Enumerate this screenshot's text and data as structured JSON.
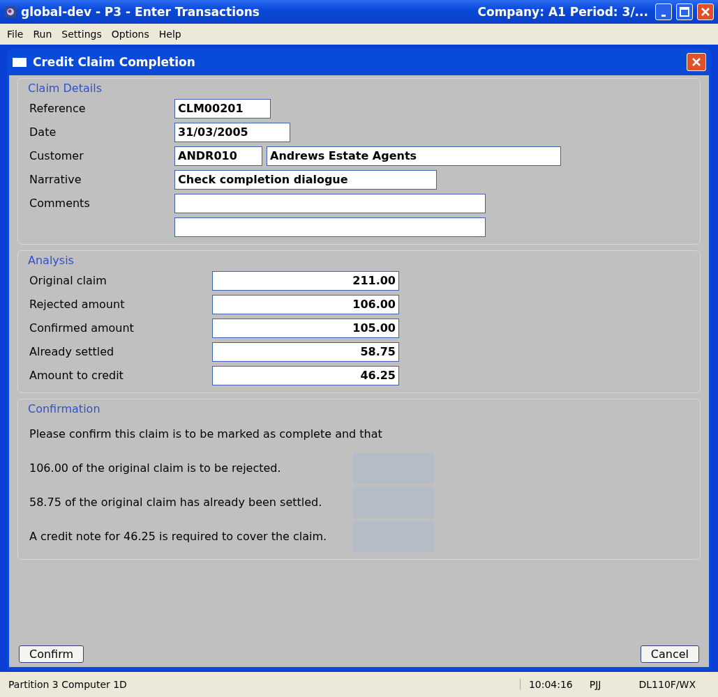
{
  "window": {
    "title": "global-dev - P3 - Enter Transactions",
    "info": "Company: A1  Period:  3/..."
  },
  "menu": [
    "File",
    "Run",
    "Settings",
    "Options",
    "Help"
  ],
  "dialog": {
    "title": "Credit Claim Completion"
  },
  "claim_details": {
    "title": "Claim Details",
    "fields": [
      {
        "kind": "filled",
        "label": "Reference",
        "values": [
          "CLM00201"
        ]
      },
      {
        "kind": "filled",
        "label": "Date",
        "values": [
          "31/03/2005"
        ]
      },
      {
        "kind": "filled",
        "label": "Customer",
        "values": [
          "ANDR010",
          "Andrews Estate Agents"
        ]
      },
      {
        "kind": "filled",
        "label": "Narrative",
        "values": [
          "Check completion dialogue"
        ]
      },
      {
        "kind": "empty",
        "label": "Comments"
      },
      {
        "kind": "empty"
      }
    ]
  },
  "analysis": {
    "title": "Analysis",
    "fields": [
      {
        "label": "Original claim",
        "value": "211.00"
      },
      {
        "label": "Rejected amount",
        "value": "106.00"
      },
      {
        "label": "Confirmed amount",
        "value": "105.00"
      },
      {
        "label": "Already settled",
        "value": "58.75"
      },
      {
        "label": "Amount to credit",
        "value": "46.25"
      }
    ]
  },
  "confirmation": {
    "title": "Confirmation",
    "lines": [
      "Please confirm this claim is to be marked as complete and that",
      "106.00 of the original claim is to be rejected.",
      "58.75 of the original claim has already been settled.",
      "A credit note for 46.25 is required to cover the claim."
    ]
  },
  "buttons": [
    "Confirm",
    "Cancel"
  ],
  "status_bar": [
    "Partition 3 Computer 1D",
    "10:04:16",
    "PJJ",
    "DL110F/WX"
  ]
}
